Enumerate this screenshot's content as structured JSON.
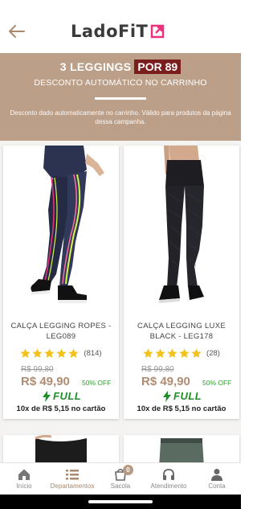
{
  "header": {
    "logo_text": "LadoFiT",
    "brand_color": "#e8327c"
  },
  "banner": {
    "title_main": "3 LEGGINGS",
    "title_highlight": "POR 89",
    "subtitle": "DESCONTO AUTOMÁTICO NO CARRINHO",
    "note": "Desconto dado automaticamente no carrinho. Válido para produtos da página dessa campanha.",
    "bg_color": "#bc9f88",
    "highlight_color": "#7a1d1d"
  },
  "products": [
    {
      "name": "CALÇA LEGGING ROPES - LEG089",
      "rating_stars": 5,
      "rating_count": "(814)",
      "old_price": "R$ 99,80",
      "price": "R$ 49,90",
      "discount": "50% OFF",
      "shipping_badge": "FULL",
      "installments": "10x de R$ 5,15 no cartão"
    },
    {
      "name": "CALÇA LEGGING LUXE BLACK - LEG178",
      "rating_stars": 5,
      "rating_count": "(28)",
      "old_price": "R$ 99,80",
      "price": "R$ 49,90",
      "discount": "50% OFF",
      "shipping_badge": "FULL",
      "installments": "10x de R$ 5,15 no cartão"
    }
  ],
  "bottom_nav": {
    "items": [
      {
        "label": "Início",
        "icon": "home-icon"
      },
      {
        "label": "Departamentos",
        "icon": "list-icon",
        "active": true
      },
      {
        "label": "Sacola",
        "icon": "bag-icon",
        "badge": "0"
      },
      {
        "label": "Atendimento",
        "icon": "headset-icon"
      },
      {
        "label": "Conta",
        "icon": "user-icon"
      }
    ]
  },
  "colors": {
    "price": "#b08d72",
    "star": "#f2c21b",
    "discount": "#2e9e2e",
    "full": "#1f8f2a"
  }
}
